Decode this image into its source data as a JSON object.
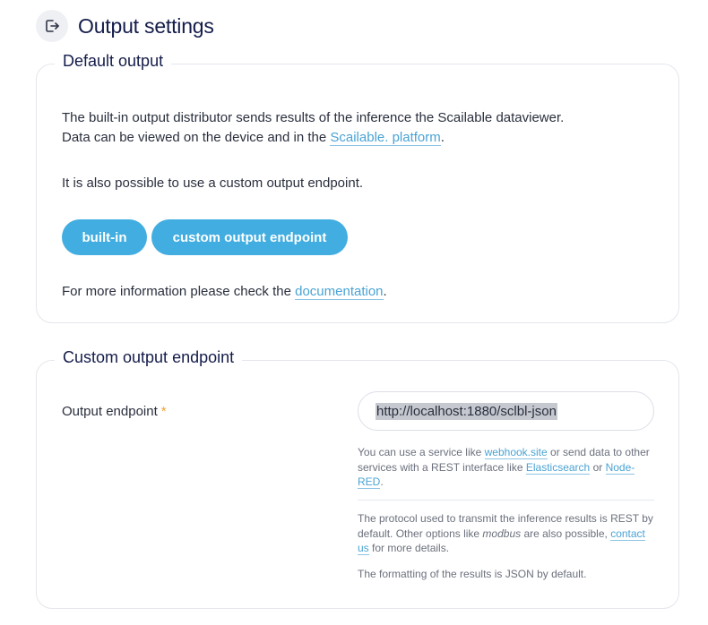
{
  "header": {
    "title": "Output settings",
    "icon": "logout-icon"
  },
  "default_output": {
    "legend": "Default output",
    "desc_line1": "The built-in output distributor sends results of the inference the Scailable dataviewer.",
    "desc_line2_prefix": "Data can be viewed on the device and in the ",
    "desc_line2_link": "Scailable. platform",
    "desc_line2_suffix": ".",
    "custom_note": "It is also possible to use a custom output endpoint.",
    "buttons": {
      "builtin": "built-in",
      "custom": "custom output endpoint"
    },
    "more_prefix": "For more information please check the ",
    "more_link": "documentation",
    "more_suffix": "."
  },
  "custom_endpoint": {
    "legend": "Custom output endpoint",
    "field_label": "Output endpoint",
    "required_mark": "*",
    "field_value": "http://localhost:1880/sclbl-json",
    "help1": {
      "t1": "You can use a service like ",
      "link1": "webhook.site",
      "t2": " or send data to other services with a REST interface like ",
      "link2": "Elasticsearch",
      "t3": " or ",
      "link3": "Node-RED",
      "t4": "."
    },
    "help2": {
      "t1": "The protocol used to transmit the inference results is REST by default. Other options like ",
      "em": "modbus",
      "t2": " are also possible, ",
      "link": "contact us",
      "t3": " for more details."
    },
    "help3": "The formatting of the results is JSON by default."
  },
  "colors": {
    "accent": "#41ade0",
    "link": "#4aa3d4",
    "required": "#f0a23a",
    "title": "#141c4a"
  }
}
